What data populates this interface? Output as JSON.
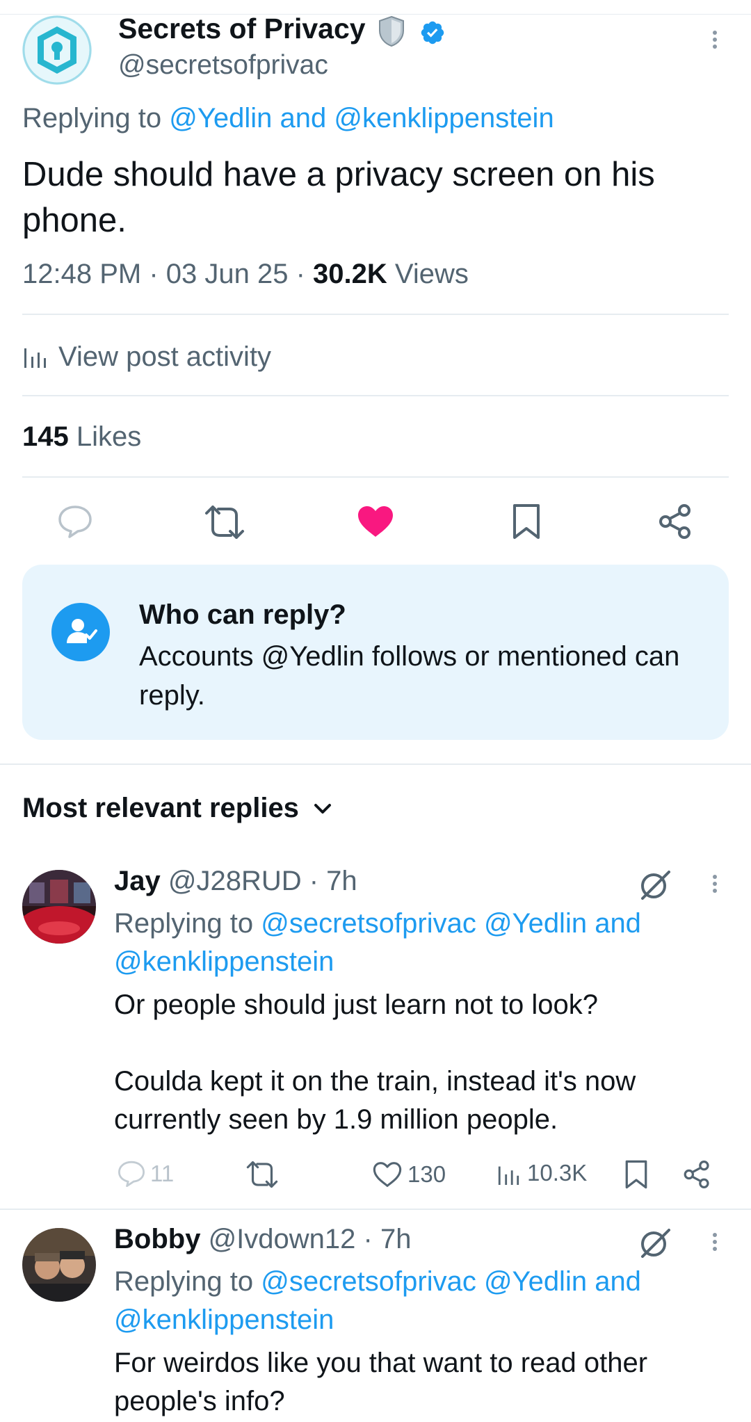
{
  "post": {
    "author_name": "Secrets of Privacy",
    "author_handle": "@secretsofprivac",
    "replying_prefix": "Replying to",
    "replying_to": "@Yedlin and @kenklippenstein",
    "text": "Dude should have a privacy screen on his phone.",
    "time": "12:48 PM · 03 Jun 25 ·",
    "views_count": "30.2K",
    "views_label": "Views",
    "view_activity": "View post activity",
    "likes_count": "145",
    "likes_label": "Likes"
  },
  "who_can_reply": {
    "title": "Who can reply?",
    "body": "Accounts @Yedlin follows or mentioned can reply."
  },
  "replies_header": {
    "label": "Most relevant replies"
  },
  "replies": [
    {
      "name": "Jay",
      "handle": "@J28RUD · 7h",
      "replying_prefix": "Replying to",
      "replying_to_line1": "@secretsofprivac @Yedlin and",
      "replying_to_line2": "@kenklippenstein",
      "text_p1": "Or people should just learn not to look?",
      "text_p2": "Coulda kept it on the train, instead it's now currently seen by 1.9 million people.",
      "comments": "11",
      "likes": "130",
      "views": "10.3K"
    },
    {
      "name": "Bobby",
      "handle": "@Ivdown12 · 7h",
      "replying_prefix": "Replying to",
      "replying_to_line1": "@secretsofprivac @Yedlin and",
      "replying_to_line2": "@kenklippenstein",
      "text_p1": "For weirdos like you that want to read other people's info?"
    }
  ],
  "colors": {
    "accent": "#1d9bf0",
    "like": "#f91880",
    "text": "#0f1419",
    "muted": "#536471",
    "panel": "#e8f5fd"
  }
}
